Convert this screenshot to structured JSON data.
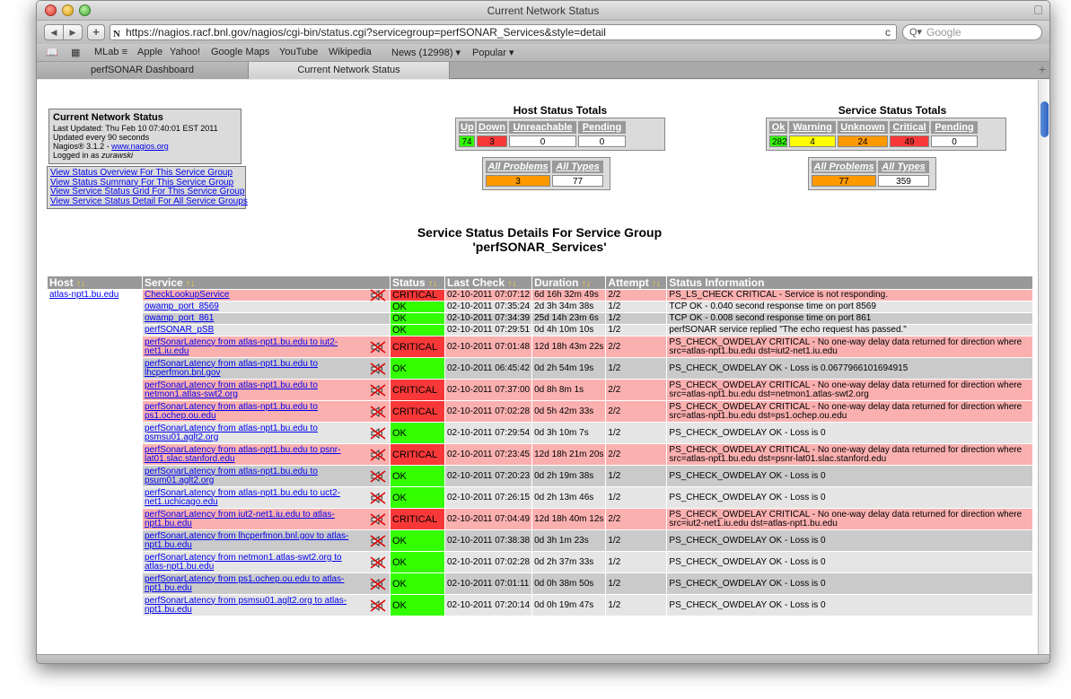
{
  "window": {
    "title": "Current Network Status"
  },
  "toolbar": {
    "back": "◀",
    "forward": "▶",
    "add": "+",
    "url": "https://nagios.racf.bnl.gov/nagios/cgi-bin/status.cgi?servicegroup=perfSONAR_Services&style=detail",
    "reload": "c",
    "search_placeholder": "Google",
    "search_icon_glyph": "Q▾"
  },
  "bookmarks": [
    "MLab ≡",
    "Apple",
    "Yahoo!",
    "Google Maps",
    "YouTube",
    "Wikipedia",
    "News (12998) ▾",
    "Popular ▾"
  ],
  "tabs": [
    "perfSONAR Dashboard",
    "Current Network Status"
  ],
  "info": {
    "title": "Current Network Status",
    "updated": "Last Updated: Thu Feb 10 07:40:01 EST 2011",
    "interval": "Updated every 90 seconds",
    "version_prefix": "Nagios® 3.1.2 - ",
    "version_link": "www.nagios.org",
    "login_prefix": "Logged in as ",
    "login_user": "zurawski"
  },
  "links": [
    "View Status Overview For This Service Group",
    "View Status Summary For This Service Group",
    "View Service Status Grid For This Service Group",
    "View Service Status Detail For All Service Groups"
  ],
  "host_totals": {
    "title": "Host Status Totals",
    "headers": [
      "Up",
      "Down",
      "Unreachable",
      "Pending"
    ],
    "values": [
      "74",
      "3",
      "0",
      "0"
    ],
    "sub_headers": [
      "All Problems",
      "All Types"
    ],
    "sub_values": [
      "3",
      "77"
    ]
  },
  "service_totals": {
    "title": "Service Status Totals",
    "headers": [
      "Ok",
      "Warning",
      "Unknown",
      "Critical",
      "Pending"
    ],
    "values": [
      "282",
      "4",
      "24",
      "49",
      "0"
    ],
    "sub_headers": [
      "All Problems",
      "All Types"
    ],
    "sub_values": [
      "77",
      "359"
    ]
  },
  "group_title": {
    "line1": "Service Status Details For Service Group",
    "line2": "'perfSONAR_Services'"
  },
  "table": {
    "sort_glyph": "↑↓",
    "columns": [
      "Host",
      "Service",
      "Status",
      "Last Check",
      "Duration",
      "Attempt",
      "Status Information"
    ],
    "rows": [
      {
        "host": "atlas-npt1.bu.edu",
        "service": "CheckLookupService",
        "status": "CRITICAL",
        "last_check": "02-10-2011 07:07:12",
        "duration": "6d 16h 32m 49s",
        "attempt": "2/2",
        "info": "PS_LS_CHECK CRITICAL - Service is not responding.",
        "flap": true
      },
      {
        "host": "",
        "service": "owamp_port_8569",
        "status": "OK",
        "last_check": "02-10-2011 07:35:24",
        "duration": "2d 3h 34m 38s",
        "attempt": "1/2",
        "info": "TCP OK - 0.040 second response time on port 8569",
        "flap": false
      },
      {
        "host": "",
        "service": "owamp_port_861",
        "status": "OK",
        "last_check": "02-10-2011 07:34:39",
        "duration": "25d 14h 23m 6s",
        "attempt": "1/2",
        "info": "TCP OK - 0.008 second response time on port 861",
        "flap": false
      },
      {
        "host": "",
        "service": "perfSONAR_pSB",
        "status": "OK",
        "last_check": "02-10-2011 07:29:51",
        "duration": "0d 4h 10m 10s",
        "attempt": "1/2",
        "info": "perfSONAR service replied \"The echo request has passed.\"",
        "flap": false
      },
      {
        "host": "",
        "service": "perfSonarLatency from atlas-npt1.bu.edu to iut2-net1.iu.edu",
        "status": "CRITICAL",
        "last_check": "02-10-2011 07:01:48",
        "duration": "12d 18h 43m 22s",
        "attempt": "2/2",
        "info": "PS_CHECK_OWDELAY CRITICAL - No one-way delay data returned for direction where src=atlas-npt1.bu.edu dst=iut2-net1.iu.edu",
        "flap": true
      },
      {
        "host": "",
        "service": "perfSonarLatency from atlas-npt1.bu.edu to lhcperfmon.bnl.gov",
        "status": "OK",
        "last_check": "02-10-2011 06:45:42",
        "duration": "0d 2h 54m 19s",
        "attempt": "1/2",
        "info": "PS_CHECK_OWDELAY OK - Loss is 0.0677966101694915",
        "flap": true
      },
      {
        "host": "",
        "service": "perfSonarLatency from atlas-npt1.bu.edu to netmon1.atlas-swt2.org",
        "status": "CRITICAL",
        "last_check": "02-10-2011 07:37:00",
        "duration": "0d 8h 8m 1s",
        "attempt": "2/2",
        "info": "PS_CHECK_OWDELAY CRITICAL - No one-way delay data returned for direction where src=atlas-npt1.bu.edu dst=netmon1.atlas-swt2.org",
        "flap": true
      },
      {
        "host": "",
        "service": "perfSonarLatency from atlas-npt1.bu.edu to ps1.ochep.ou.edu",
        "status": "CRITICAL",
        "last_check": "02-10-2011 07:02:28",
        "duration": "0d 5h 42m 33s",
        "attempt": "2/2",
        "info": "PS_CHECK_OWDELAY CRITICAL - No one-way delay data returned for direction where src=atlas-npt1.bu.edu dst=ps1.ochep.ou.edu",
        "flap": true
      },
      {
        "host": "",
        "service": "perfSonarLatency from atlas-npt1.bu.edu to psmsu01.aglt2.org",
        "status": "OK",
        "last_check": "02-10-2011 07:29:54",
        "duration": "0d 3h 10m 7s",
        "attempt": "1/2",
        "info": "PS_CHECK_OWDELAY OK - Loss is 0",
        "flap": true
      },
      {
        "host": "",
        "service": "perfSonarLatency from atlas-npt1.bu.edu to psnr-lat01.slac.stanford.edu",
        "status": "CRITICAL",
        "last_check": "02-10-2011 07:23:45",
        "duration": "12d 18h 21m 20s",
        "attempt": "2/2",
        "info": "PS_CHECK_OWDELAY CRITICAL - No one-way delay data returned for direction where src=atlas-npt1.bu.edu dst=psnr-lat01.slac.stanford.edu",
        "flap": true
      },
      {
        "host": "",
        "service": "perfSonarLatency from atlas-npt1.bu.edu to psum01.aglt2.org",
        "status": "OK",
        "last_check": "02-10-2011 07:20:23",
        "duration": "0d 2h 19m 38s",
        "attempt": "1/2",
        "info": "PS_CHECK_OWDELAY OK - Loss is 0",
        "flap": true
      },
      {
        "host": "",
        "service": "perfSonarLatency from atlas-npt1.bu.edu to uct2-net1.uchicago.edu",
        "status": "OK",
        "last_check": "02-10-2011 07:26:15",
        "duration": "0d 2h 13m 46s",
        "attempt": "1/2",
        "info": "PS_CHECK_OWDELAY OK - Loss is 0",
        "flap": true
      },
      {
        "host": "",
        "service": "perfSonarLatency from iut2-net1.iu.edu to atlas-npt1.bu.edu",
        "status": "CRITICAL",
        "last_check": "02-10-2011 07:04:49",
        "duration": "12d 18h 40m 12s",
        "attempt": "2/2",
        "info": "PS_CHECK_OWDELAY CRITICAL - No one-way delay data returned for direction where src=iut2-net1.iu.edu dst=atlas-npt1.bu.edu",
        "flap": true
      },
      {
        "host": "",
        "service": "perfSonarLatency from lhcperfmon.bnl.gov to atlas-npt1.bu.edu",
        "status": "OK",
        "last_check": "02-10-2011 07:38:38",
        "duration": "0d 3h 1m 23s",
        "attempt": "1/2",
        "info": "PS_CHECK_OWDELAY OK - Loss is 0",
        "flap": true
      },
      {
        "host": "",
        "service": "perfSonarLatency from netmon1.atlas-swt2.org to atlas-npt1.bu.edu",
        "status": "OK",
        "last_check": "02-10-2011 07:02:28",
        "duration": "0d 2h 37m 33s",
        "attempt": "1/2",
        "info": "PS_CHECK_OWDELAY OK - Loss is 0",
        "flap": true
      },
      {
        "host": "",
        "service": "perfSonarLatency from ps1.ochep.ou.edu to atlas-npt1.bu.edu",
        "status": "OK",
        "last_check": "02-10-2011 07:01:11",
        "duration": "0d 0h 38m 50s",
        "attempt": "1/2",
        "info": "PS_CHECK_OWDELAY OK - Loss is 0",
        "flap": true
      },
      {
        "host": "",
        "service": "perfSonarLatency from psmsu01.aglt2.org to atlas-npt1.bu.edu",
        "status": "OK",
        "last_check": "02-10-2011 07:20:14",
        "duration": "0d 0h 19m 47s",
        "attempt": "1/2",
        "info": "PS_CHECK_OWDELAY OK - Loss is 0",
        "flap": true
      }
    ]
  }
}
